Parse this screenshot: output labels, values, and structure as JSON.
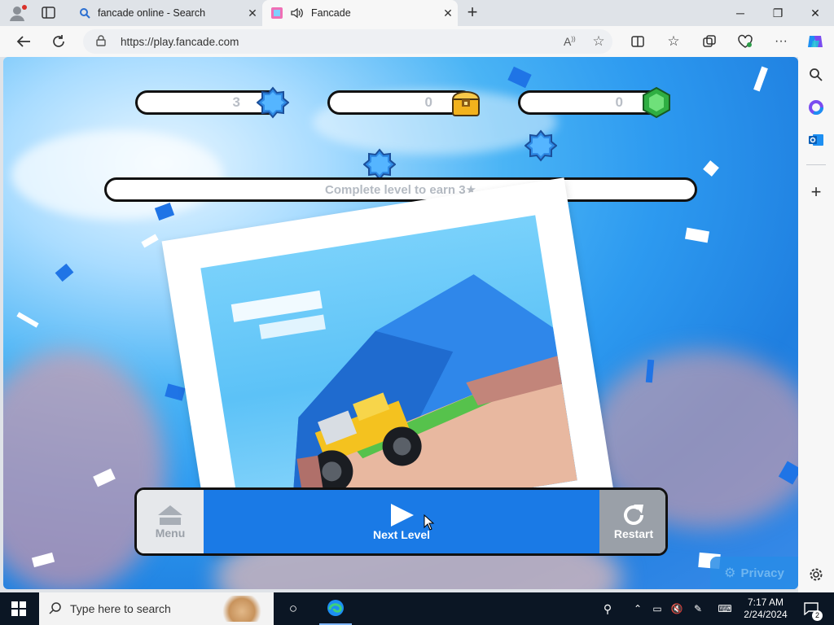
{
  "browser": {
    "tabs": [
      {
        "title": "fancade online - Search",
        "icon": "search-icon",
        "active": false
      },
      {
        "title": "Fancade",
        "icon": "fancade-favicon",
        "active": true
      }
    ],
    "new_tab_label": "+",
    "url": "https://play.fancade.com"
  },
  "game": {
    "counters": [
      {
        "value": "3",
        "icon": "blue-star-badge-icon"
      },
      {
        "value": "0",
        "icon": "treasure-chest-icon"
      },
      {
        "value": "0",
        "icon": "green-gem-icon"
      }
    ],
    "progress_text": "Complete level to earn 3★",
    "buttons": {
      "menu": "Menu",
      "next": "Next Level",
      "restart": "Restart"
    },
    "privacy": "Privacy"
  },
  "taskbar": {
    "search_placeholder": "Type here to search",
    "time": "7:17 AM",
    "date": "2/24/2024",
    "notification_count": "2"
  },
  "colors": {
    "accent_blue": "#1a7ae6",
    "restart_gray": "#9aa0a8",
    "gem_green": "#35c44a",
    "chest_gold": "#f2b21d"
  }
}
